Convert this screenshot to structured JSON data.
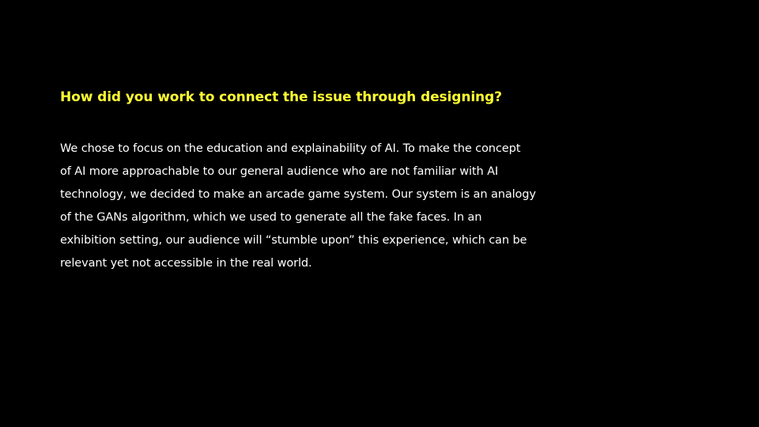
{
  "slide": {
    "heading": "How did you work to connect the issue through designing?",
    "body_lines": [
      "We chose to focus on the education and explainability of AI. To make the concept",
      "of AI more approachable to our general audience who are not familiar with AI",
      "technology, we decided to make an arcade game system. Our system is an analogy",
      "of the GANs algorithm, which we used to generate all the fake faces. In an",
      "exhibition setting, our audience will “stumble upon” this experience, which can be",
      "relevant yet not accessible in the real world."
    ]
  },
  "colors": {
    "background": "#000000",
    "heading": "#ffff33",
    "body": "#ffffff"
  }
}
